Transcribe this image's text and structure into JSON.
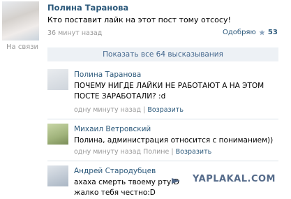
{
  "post": {
    "author": "Полина Таранова",
    "text": "Кто поставит лайк на этот пост тому отсосу!",
    "time": "36 минут назад",
    "status": "На связи",
    "like_label": "Одобряю",
    "like_count": "53"
  },
  "show_all": "Показать все 64 высказывания",
  "comments": [
    {
      "author": "Полина Таранова",
      "text": "ПОЧЕМУ НИГДЕ ЛАЙКИ НЕ РАБОТАЮТ А НА ЭТОМ ПОСТЕ ЗАРАБОТАЛИ? :d",
      "time": "одну минуту назад",
      "reply": "Возразить"
    },
    {
      "author": "Михаил Ветровский",
      "text": "Полина, администрация относится с пониманием))",
      "time": "одну минуту назад Полине",
      "reply": "Возразить"
    },
    {
      "author": "Андрей Стародубцев",
      "text_line1": "ахаха смерть твоему рту:D",
      "text_line2": "жалко тебя честно:D"
    }
  ],
  "watermark": "YAPLAKAL.COM"
}
